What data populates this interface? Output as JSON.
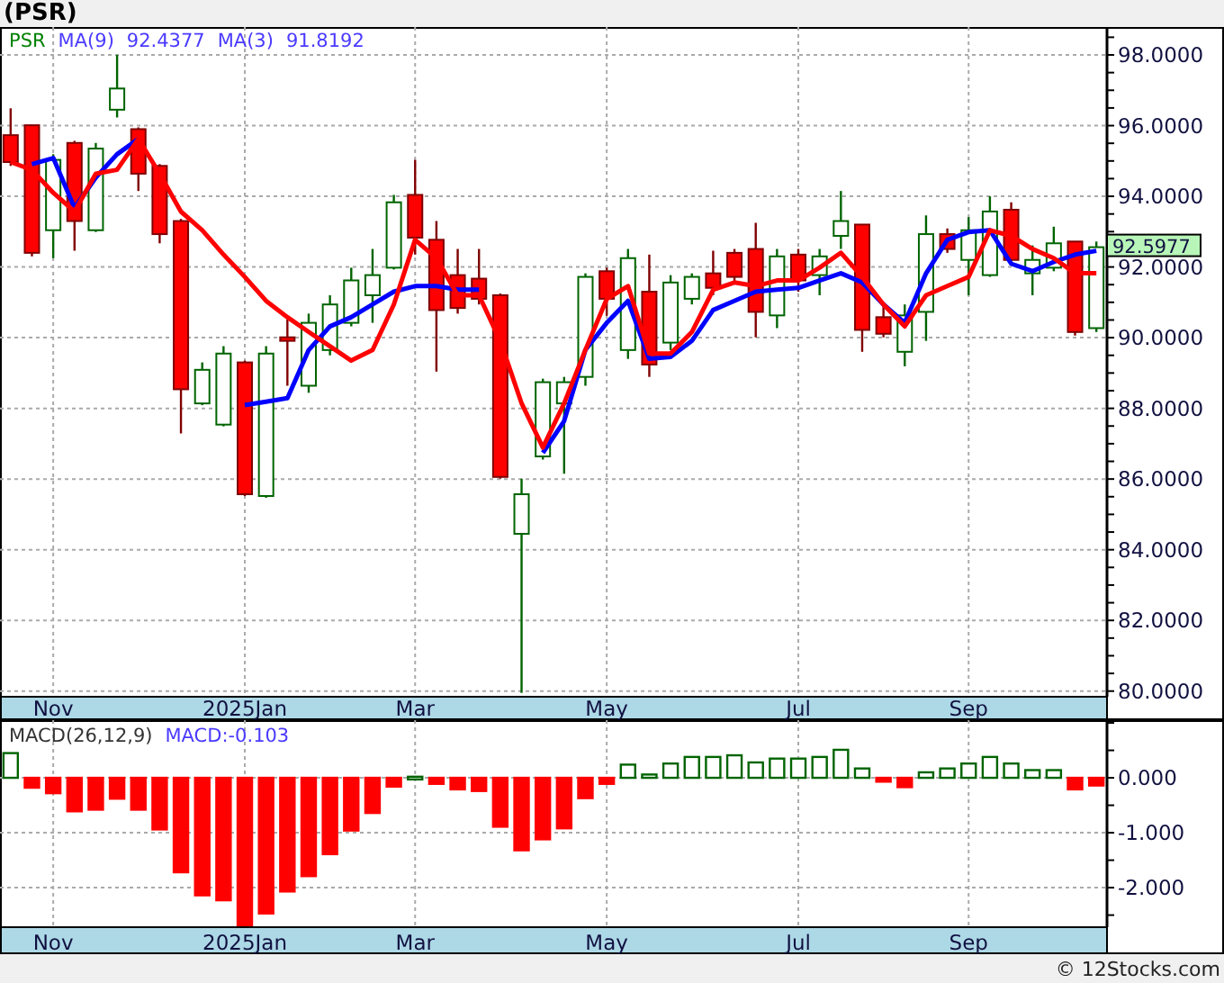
{
  "title": "(PSR)",
  "price_panel": {
    "symbol": "PSR",
    "series_values": [
      "92.4377",
      "91.8192"
    ],
    "last_price": "92.5977",
    "chart_data": {
      "type": "candlestick",
      "grid": true,
      "ylim": [
        79.84,
        98.79
      ],
      "categories": [
        null,
        null,
        "Nov",
        null,
        null,
        null,
        null,
        null,
        null,
        null,
        null,
        "2025Jan",
        null,
        null,
        null,
        null,
        null,
        null,
        null,
        "Mar",
        null,
        null,
        null,
        null,
        null,
        null,
        null,
        null,
        "May",
        null,
        null,
        null,
        null,
        null,
        null,
        null,
        null,
        "Jul",
        null,
        null,
        null,
        null,
        null,
        null,
        null,
        "Sep",
        null,
        null,
        null,
        null,
        null,
        null
      ],
      "yticks": [
        {
          "value": 98,
          "label": "98.0000"
        },
        {
          "value": 96,
          "label": "96.0000"
        },
        {
          "value": 94,
          "label": "94.0000"
        },
        {
          "value": 92,
          "label": "92.0000"
        },
        {
          "value": 90,
          "label": "90.0000"
        },
        {
          "value": 88,
          "label": "88.0000"
        },
        {
          "value": 86,
          "label": "86.0000"
        },
        {
          "value": 84,
          "label": "84.0000"
        },
        {
          "value": 82,
          "label": "82.0000"
        },
        {
          "value": 80,
          "label": "80.0000"
        }
      ],
      "series": [
        {
          "name": "MA(9)",
          "type": "line",
          "color": "#0000ff",
          "values": [
            null,
            94.91,
            95.08,
            93.67,
            94.53,
            95.19,
            95.62,
            null,
            null,
            null,
            null,
            88.09,
            88.19,
            88.29,
            89.65,
            90.32,
            90.58,
            90.94,
            91.3,
            91.46,
            91.46,
            91.36,
            91.36,
            null,
            null,
            86.74,
            87.64,
            89.65,
            90.42,
            91.04,
            89.4,
            89.45,
            89.91,
            90.78,
            91.04,
            91.3,
            91.36,
            91.41,
            91.62,
            91.82,
            91.56,
            90.94,
            90.42,
            91.82,
            92.77,
            92.99,
            93.04,
            92.09,
            91.88,
            92.14,
            92.35,
            92.46
          ]
        },
        {
          "name": "MA(3)",
          "type": "line",
          "color": "#ff0000",
          "values": [
            94.97,
            94.75,
            94.1,
            93.57,
            94.64,
            94.75,
            95.62,
            94.64,
            93.57,
            93.04,
            92.35,
            91.72,
            91.04,
            90.58,
            90.16,
            89.76,
            89.35,
            89.65,
            90.94,
            92.77,
            92.25,
            91.2,
            91.2,
            89.91,
            88.14,
            86.89,
            88.14,
            89.65,
            91.1,
            91.46,
            89.55,
            89.55,
            90.16,
            91.36,
            91.56,
            91.46,
            91.62,
            91.62,
            91.98,
            92.4,
            91.72,
            90.94,
            90.32,
            91.2,
            91.46,
            91.72,
            93.04,
            92.88,
            92.51,
            92.25,
            91.82,
            91.82
          ]
        }
      ],
      "ohlc": [
        [
          95.73,
          96.49,
          94.86,
          94.97
        ],
        [
          96.01,
          96.01,
          92.3,
          92.4
        ],
        [
          93.04,
          95.19,
          92.25,
          95.03
        ],
        [
          95.51,
          95.57,
          92.46,
          93.3
        ],
        [
          93.04,
          95.51,
          92.99,
          95.35
        ],
        [
          96.45,
          98.0,
          96.23,
          97.05
        ],
        [
          95.9,
          95.95,
          94.15,
          94.64
        ],
        [
          94.86,
          94.91,
          92.67,
          92.93
        ],
        [
          93.3,
          93.36,
          87.29,
          88.54
        ],
        [
          88.14,
          89.3,
          88.09,
          89.09
        ],
        [
          87.54,
          89.76,
          87.49,
          89.55
        ],
        [
          89.3,
          89.35,
          85.52,
          85.57
        ],
        [
          85.52,
          89.76,
          85.47,
          89.55
        ],
        [
          90.01,
          90.52,
          88.64,
          89.91
        ],
        [
          88.64,
          90.68,
          88.44,
          90.42
        ],
        [
          89.65,
          91.2,
          89.5,
          90.94
        ],
        [
          90.42,
          91.98,
          90.32,
          91.62
        ],
        [
          91.2,
          92.51,
          90.42,
          91.77
        ],
        [
          91.98,
          94.04,
          91.93,
          93.83
        ],
        [
          94.04,
          95.03,
          92.35,
          92.83
        ],
        [
          92.77,
          93.3,
          89.04,
          90.78
        ],
        [
          91.77,
          92.51,
          90.68,
          90.84
        ],
        [
          91.67,
          92.51,
          90.94,
          91.1
        ],
        [
          91.2,
          91.25,
          86.01,
          86.06
        ],
        [
          84.45,
          86.01,
          79.95,
          85.57
        ],
        [
          86.64,
          88.84,
          86.55,
          88.74
        ],
        [
          88.14,
          88.89,
          86.15,
          88.74
        ],
        [
          88.89,
          91.82,
          88.64,
          91.72
        ],
        [
          91.88,
          91.98,
          90.62,
          91.1
        ],
        [
          89.65,
          92.51,
          89.4,
          92.25
        ],
        [
          91.3,
          92.35,
          88.89,
          89.24
        ],
        [
          89.86,
          91.77,
          89.65,
          91.56
        ],
        [
          91.1,
          91.82,
          90.94,
          91.72
        ],
        [
          91.82,
          92.46,
          91.2,
          91.41
        ],
        [
          92.4,
          92.51,
          91.56,
          91.72
        ],
        [
          92.51,
          93.25,
          90.01,
          90.73
        ],
        [
          90.63,
          92.51,
          90.27,
          92.3
        ],
        [
          92.35,
          92.51,
          91.3,
          91.62
        ],
        [
          91.77,
          92.51,
          91.2,
          92.3
        ],
        [
          92.88,
          94.15,
          92.51,
          93.3
        ],
        [
          93.2,
          93.2,
          89.6,
          90.22
        ],
        [
          90.58,
          90.94,
          90.01,
          90.11
        ],
        [
          89.6,
          90.94,
          89.19,
          90.63
        ],
        [
          90.73,
          93.46,
          89.91,
          92.93
        ],
        [
          92.93,
          93.09,
          92.4,
          92.51
        ],
        [
          92.2,
          93.41,
          91.2,
          93.04
        ],
        [
          91.77,
          94.0,
          91.72,
          93.57
        ],
        [
          93.62,
          93.83,
          92.04,
          92.2
        ],
        [
          91.82,
          92.61,
          91.2,
          92.2
        ],
        [
          91.98,
          93.14,
          91.88,
          92.67
        ],
        [
          92.72,
          92.72,
          90.06,
          90.16
        ],
        [
          90.27,
          92.72,
          90.16,
          92.56
        ]
      ]
    }
  },
  "macd_panel": {
    "legend": [
      {
        "kind": "label",
        "text": "MACD(26,12,9)"
      },
      {
        "kind": "indicator",
        "text": "MACD:-0.103"
      }
    ],
    "chart_data": {
      "type": "bar",
      "grid": true,
      "ylim": [
        -2.72,
        1.05
      ],
      "categories": [
        null,
        null,
        "Nov",
        null,
        null,
        null,
        null,
        null,
        null,
        null,
        null,
        "2025Jan",
        null,
        null,
        null,
        null,
        null,
        null,
        null,
        "Mar",
        null,
        null,
        null,
        null,
        null,
        null,
        null,
        null,
        "May",
        null,
        null,
        null,
        null,
        null,
        null,
        null,
        null,
        "Jul",
        null,
        null,
        null,
        null,
        null,
        null,
        null,
        "Sep",
        null,
        null,
        null,
        null,
        null,
        null
      ],
      "yticks": [
        {
          "value": 0,
          "label": "0.000"
        },
        {
          "value": -1,
          "label": "-1.000"
        },
        {
          "value": -2,
          "label": "-2.000"
        }
      ],
      "values": [
        0.45,
        -0.18,
        -0.28,
        -0.61,
        -0.58,
        -0.38,
        -0.58,
        -0.94,
        -1.72,
        -2.14,
        -2.23,
        -2.71,
        -2.47,
        -2.07,
        -1.79,
        -1.39,
        -0.96,
        -0.64,
        -0.16,
        0.02,
        -0.11,
        -0.21,
        -0.24,
        -0.89,
        -1.32,
        -1.12,
        -0.92,
        -0.37,
        -0.11,
        0.24,
        0.06,
        0.26,
        0.38,
        0.38,
        0.41,
        0.28,
        0.35,
        0.35,
        0.38,
        0.51,
        0.17,
        -0.07,
        -0.17,
        0.1,
        0.17,
        0.26,
        0.38,
        0.26,
        0.14,
        0.14,
        -0.21,
        -0.14
      ]
    }
  },
  "footer": "© 12Stocks.com"
}
